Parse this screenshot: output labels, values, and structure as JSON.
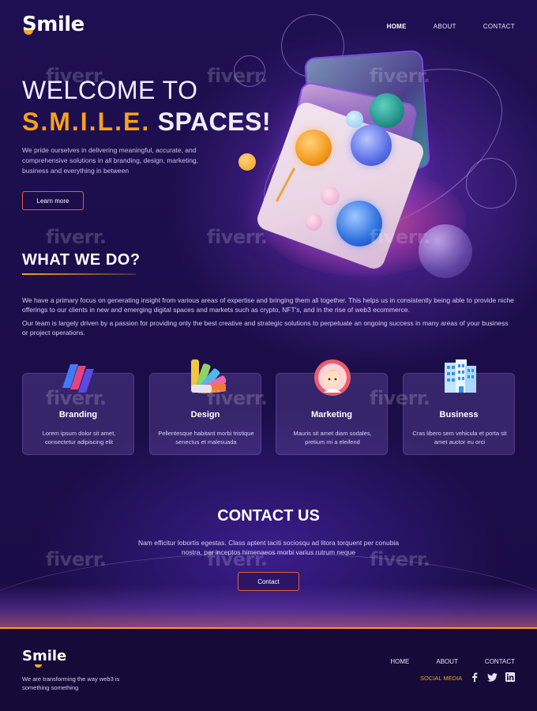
{
  "brand": {
    "name": "Smile",
    "accent": "#f6a21c"
  },
  "nav": {
    "items": [
      "HOME",
      "ABOUT",
      "CONTACT"
    ],
    "active": "HOME"
  },
  "hero": {
    "line1": "WELCOME TO",
    "accent": "S.M.I.L.E.",
    "line2_rest": " SPACES!",
    "description": "We pride ourselves in delivering meaningful, accurate, and comprehensive solutions in all branding, design, marketing, business and everything in between",
    "button": "Learn more"
  },
  "what_we_do": {
    "title": "WHAT WE DO?",
    "paragraph1": "We have a primary focus on generating insight from various areas of expertise and bringing them all together. This helps us in consistently being able to provide niche offerings to our clients in new and emerging digital spaces and markets such as crypto, NFT's, and in the rise of web3 ecommerce.",
    "paragraph2": "Our team is largely driven by a passion for providing only the best creative and strategic solutions to perpetuate an ongoing success in many areas of your business or project operations."
  },
  "services": [
    {
      "title": "Branding",
      "text": "Lorem ipsum dolor sit amet, consectetur adipiscing elit",
      "icon": "branding-icon"
    },
    {
      "title": "Design",
      "text": "Pellentesque habitant morbi tristique senectus et malesuada",
      "icon": "palette-icon"
    },
    {
      "title": "Marketing",
      "text": "Mauris sit amet diam sodales, pretium mi a eleifend",
      "icon": "avatar-icon"
    },
    {
      "title": "Business",
      "text": "Cras libero sem vehicula et porta sit amet auctor eu orci",
      "icon": "building-icon"
    }
  ],
  "contact": {
    "title": "CONTACT US",
    "text": "Nam efficitur lobortis egestas. Class aptent taciti sociosqu ad litora torquent per conubia nostra, per inceptos himenaeos morbi varius rutrum neque",
    "button": "Contact"
  },
  "footer": {
    "brand": "Smile",
    "tagline": "We are transforming the way web3 is something something",
    "nav": [
      "HOME",
      "ABOUT",
      "CONTACT"
    ],
    "social_label": "SOCIAL MEDIA",
    "social_icons": [
      "facebook-icon",
      "twitter-icon",
      "linkedin-icon"
    ]
  },
  "watermark": "fiverr."
}
